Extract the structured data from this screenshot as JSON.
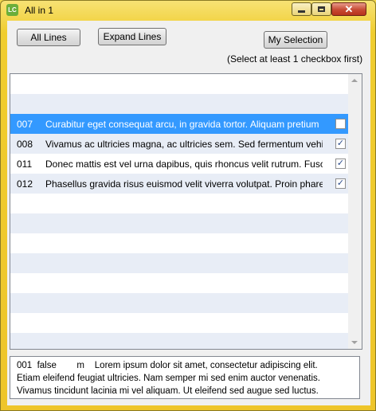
{
  "window": {
    "title": "All in 1",
    "icon_label": "LC"
  },
  "toolbar": {
    "all_lines_label": "All Lines",
    "expand_lines_label": "Expand Lines",
    "my_selection_label": "My Selection",
    "hint": "(Select at least 1 checkbox first)"
  },
  "list": {
    "rows": [
      {
        "num": "",
        "text": "",
        "checked": null
      },
      {
        "num": "",
        "text": "",
        "checked": null
      },
      {
        "num": "007",
        "text": "Curabitur eget consequat arcu, in gravida tortor. Aliquam pretium",
        "checked": false,
        "selected": true
      },
      {
        "num": "008",
        "text": "Vivamus ac ultricies magna, ac ultricies sem. Sed fermentum vehicula",
        "checked": true
      },
      {
        "num": "011",
        "text": "Donec mattis est vel urna dapibus, quis rhoncus velit rutrum. Fusce",
        "checked": true
      },
      {
        "num": "012",
        "text": "Phasellus gravida risus euismod velit viverra volutpat. Proin pharetra",
        "checked": true
      },
      {
        "num": "",
        "text": "",
        "checked": null
      },
      {
        "num": "",
        "text": "",
        "checked": null
      },
      {
        "num": "",
        "text": "",
        "checked": null
      },
      {
        "num": "",
        "text": "",
        "checked": null
      },
      {
        "num": "",
        "text": "",
        "checked": null
      },
      {
        "num": "",
        "text": "",
        "checked": null
      },
      {
        "num": "",
        "text": "",
        "checked": null
      },
      {
        "num": "",
        "text": "",
        "checked": null
      }
    ]
  },
  "detail": {
    "lines": [
      "001  false        m    Lorem ipsum dolor sit amet, consectetur adipiscing elit.",
      "Etiam eleifend feugiat ultricies. Nam semper mi sed enim auctor venenatis.",
      "Vivamus tincidunt lacinia mi vel aliquam. Ut eleifend sed augue sed luctus."
    ]
  },
  "colors": {
    "selection": "#3399ff",
    "alt_row": "#e8edf6",
    "frame": "#f0cd2f"
  }
}
